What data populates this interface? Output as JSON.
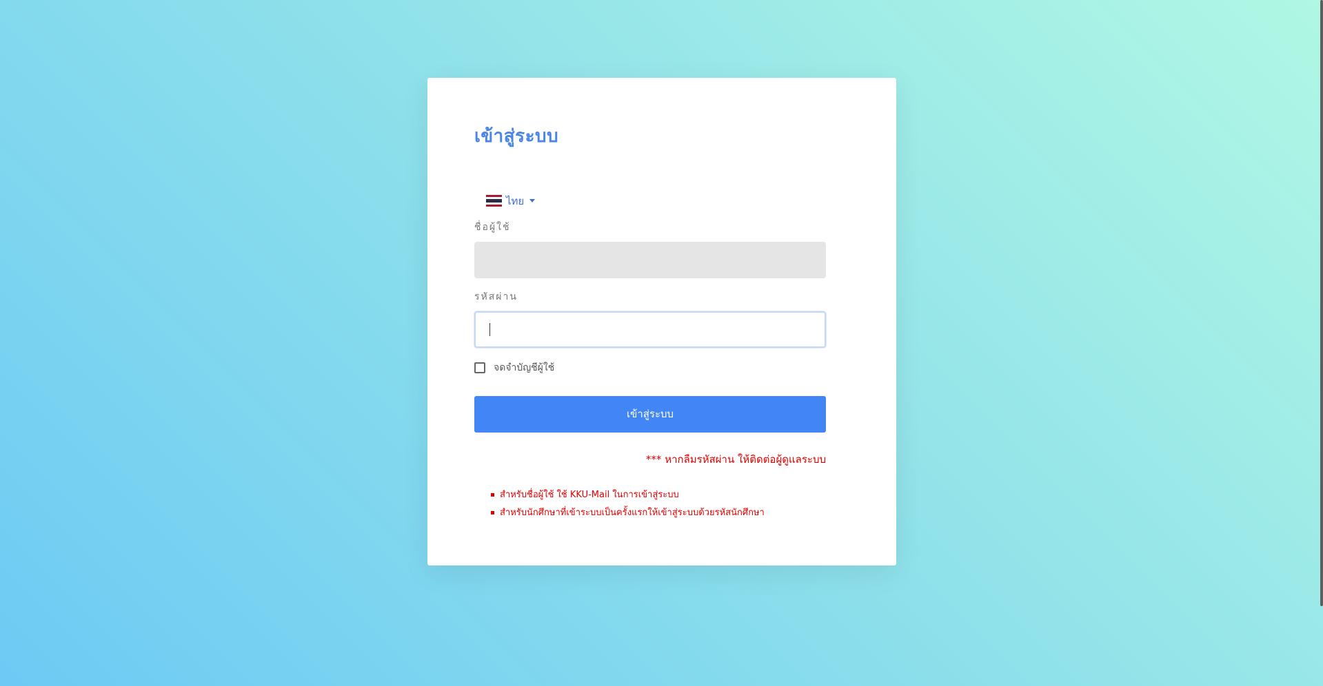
{
  "page": {
    "title": "เข้าสู่ระบบ"
  },
  "language": {
    "selected": "ไทย",
    "flag_colors": [
      "#a51931",
      "#f4f5f8",
      "#2d2a4a",
      "#f4f5f8",
      "#a51931"
    ]
  },
  "form": {
    "username_label": "ชื่อผู้ใช้",
    "username_value": "",
    "password_label": "รหัสผ่าน",
    "password_value": "",
    "remember_label": "จดจำบัญชีผู้ใช้",
    "remember_checked": false,
    "submit_label": "เข้าสู่ระบบ"
  },
  "forgot_text": "*** หากลืมรหัสผ่าน ให้ติดต่อผู้ดูแลระบบ",
  "notes": [
    "สำหรับชื่อผู้ใช้ ใช้ KKU-Mail ในการเข้าสู่ระบบ",
    "สำหรับนักศึกษาที่เข้าระบบเป็นครั้งแรกให้เข้าสู่ระบบด้วยรหัสนักศึกษา"
  ],
  "colors": {
    "accent": "#4285f4",
    "title": "#4a86e8",
    "warning": "#e00000"
  }
}
